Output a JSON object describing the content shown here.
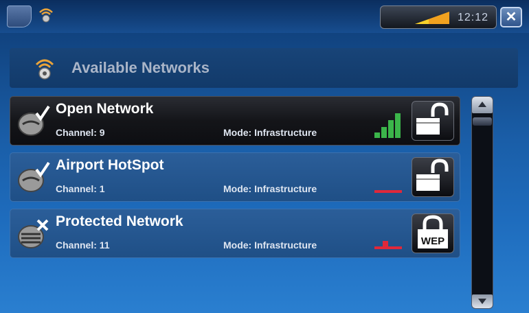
{
  "header": {
    "title": "Available Networks"
  },
  "status": {
    "time": "12:12"
  },
  "networks": [
    {
      "name": "Open Network",
      "channel": "Channel: 9",
      "mode": "Mode: Infrastructure",
      "signal": 4,
      "security": "open",
      "signal_color": "#3bb54a"
    },
    {
      "name": "Airport HotSpot",
      "channel": "Channel: 1",
      "mode": "Mode: Infrastructure",
      "signal": 0,
      "security": "open",
      "signal_color": "#e0283a"
    },
    {
      "name": "Protected Network",
      "channel": "Channel: 11",
      "mode": "Mode: Infrastructure",
      "signal": 1,
      "security": "wep",
      "signal_color": "#e0283a"
    }
  ],
  "lock_labels": {
    "wep": "WEP"
  },
  "icons": {
    "app_button": "app-menu-icon",
    "topbar": "wifi-icon",
    "battery": "signal-strength-icon",
    "close": "close-icon",
    "header": "wifi-icon",
    "network_row": "wifi-network-icon"
  },
  "close_symbol": "✕"
}
